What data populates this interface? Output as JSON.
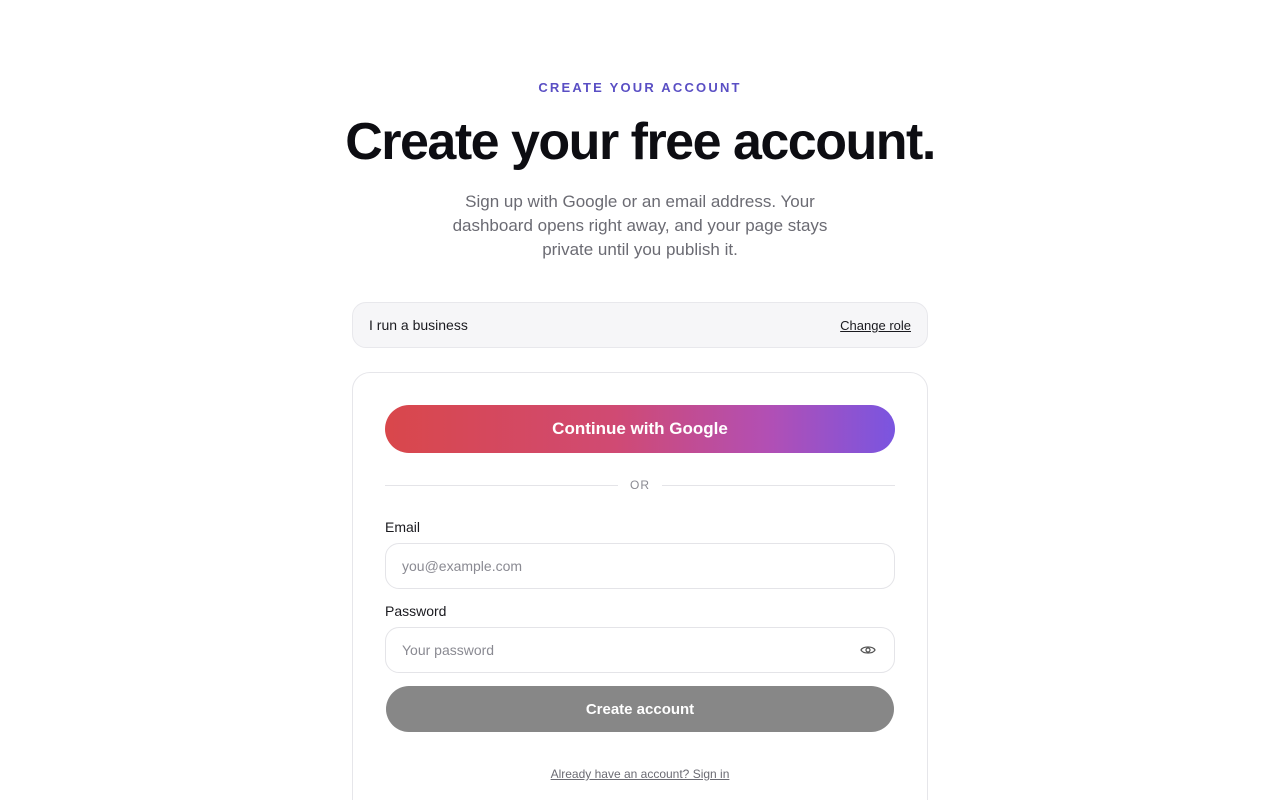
{
  "header": {
    "eyebrow": "CREATE YOUR ACCOUNT",
    "title": "Create your free account.",
    "subtitle": "Sign up with Google or an email address. Your dashboard opens right away, and your page stays private until you publish it."
  },
  "role": {
    "label": "I run a business",
    "change_link": "Change role"
  },
  "form": {
    "google_button": "Continue with Google",
    "divider": "OR",
    "email": {
      "label": "Email",
      "placeholder": "you@example.com",
      "value": ""
    },
    "password": {
      "label": "Password",
      "placeholder": "Your password",
      "value": "",
      "toggle_icon": "eye-icon"
    },
    "submit_button": "Create account",
    "signin_link": "Already have an account? Sign in"
  },
  "colors": {
    "accent": "#5a4fc4",
    "gradient_start": "#d9474b",
    "gradient_end": "#7a55e0",
    "submit_disabled": "#878787"
  }
}
